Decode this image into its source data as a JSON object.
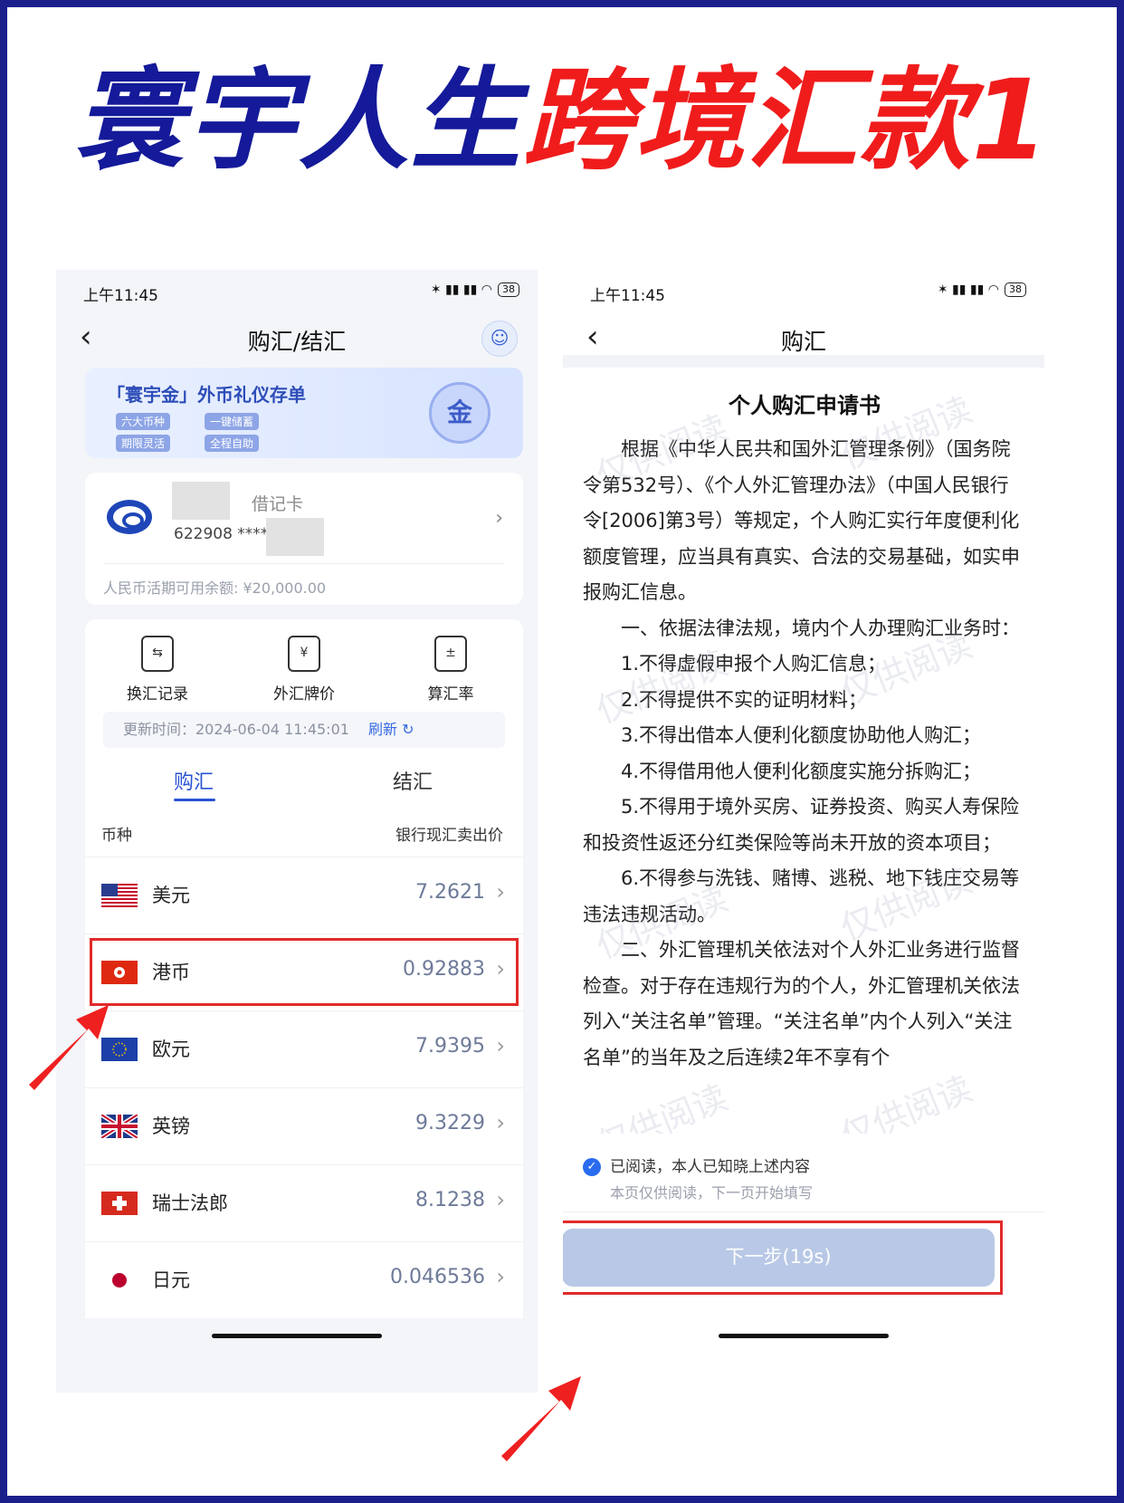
{
  "headline": {
    "part1": "寰宇人生",
    "part2": "跨境汇款1"
  },
  "left_phone": {
    "status": {
      "time": "上午11:45",
      "icons": "✶ ▮▮ ▮▮ ◠",
      "battery": "38"
    },
    "nav": {
      "title": "购汇/结汇"
    },
    "banner": {
      "title": "「寰宇金」外币礼仪存单",
      "tags": [
        "六大币种",
        "一键储蓄",
        "期限灵活",
        "全程自助"
      ],
      "coin": "金"
    },
    "card": {
      "type": "借记卡",
      "number": "622908 ****",
      "balance": "人民币活期可用余额: ¥20,000.00"
    },
    "tools": [
      {
        "label": "换汇记录"
      },
      {
        "label": "外汇牌价"
      },
      {
        "label": "算汇率"
      }
    ],
    "update": {
      "text": "更新时间：2024-06-04 11:45:01",
      "refresh": "刷新"
    },
    "tabs": [
      "购汇",
      "结汇"
    ],
    "table": {
      "col1": "币种",
      "col2": "银行现汇卖出价"
    },
    "rows": [
      {
        "name": "美元",
        "rate": "7.2621"
      },
      {
        "name": "港币",
        "rate": "0.92883"
      },
      {
        "name": "欧元",
        "rate": "7.9395"
      },
      {
        "name": "英镑",
        "rate": "9.3229"
      },
      {
        "name": "瑞士法郎",
        "rate": "8.1238"
      },
      {
        "name": "日元",
        "rate": "0.046536"
      }
    ]
  },
  "right_phone": {
    "status": {
      "time": "上午11:45",
      "icons": "✶ ▮▮ ▮▮ ◠",
      "battery": "38"
    },
    "nav": {
      "title": "购汇"
    },
    "doc": {
      "title": "个人购汇申请书",
      "p1": "根据《中华人民共和国外汇管理条例》（国务院令第532号）、《个人外汇管理办法》（中国人民银行令[2006]第3号）等规定，个人购汇实行年度便利化额度管理，应当具有真实、合法的交易基础，如实申报购汇信息。",
      "p2": "一、依据法律法规，境内个人办理购汇业务时：",
      "i1": "1.不得虚假申报个人购汇信息；",
      "i2": "2.不得提供不实的证明材料；",
      "i3": "3.不得出借本人便利化额度协助他人购汇；",
      "i4": "4.不得借用他人便利化额度实施分拆购汇；",
      "i5": "5.不得用于境外买房、证券投资、购买人寿保险和投资性返还分红类保险等尚未开放的资本项目；",
      "i6": "6.不得参与洗钱、赌博、逃税、地下钱庄交易等违法违规活动。",
      "p3": "二、外汇管理机关依法对个人外汇业务进行监督检查。对于存在违规行为的个人，外汇管理机关依法列入“关注名单”管理。“关注名单”内个人列入“关注名单”的当年及之后连续2年不享有个"
    },
    "watermark": "仅供阅读",
    "agree": "已阅读，本人已知晓上述内容",
    "note": "本页仅供阅读，下一页开始填写",
    "next_button": "下一步(19s)"
  },
  "colors": {
    "brand_blue": "#141a99",
    "accent_red": "#f01c1c",
    "link_blue": "#2a53d3"
  }
}
